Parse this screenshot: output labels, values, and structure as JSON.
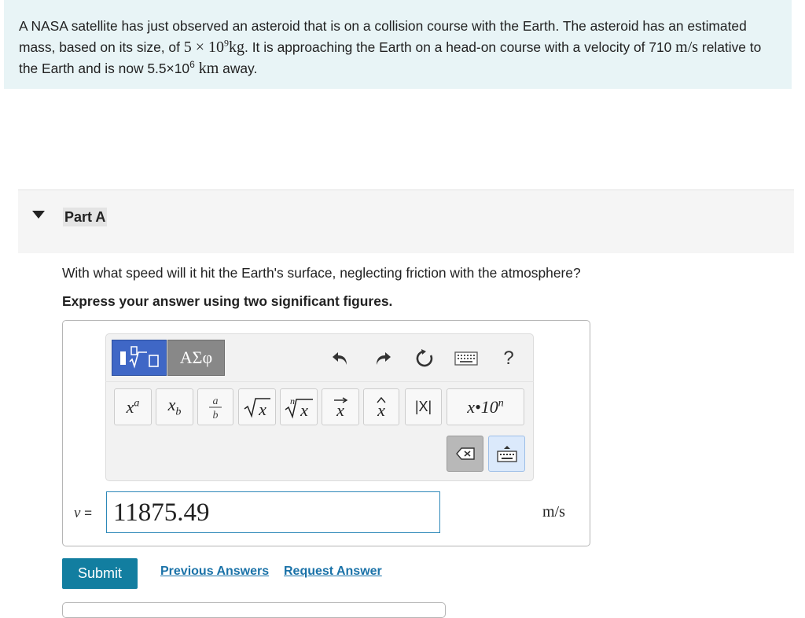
{
  "problem": {
    "text_1": "A NASA satellite has just observed an asteroid that is on a collision course with the Earth. The asteroid has an estimated mass, based on its size, of ",
    "mass_coef": "5 × 10",
    "mass_exp": "9",
    "mass_unit": "kg",
    "text_2": ". It is approaching the Earth on a head-on course with a velocity of 710 ",
    "velocity_unit": "m/s",
    "text_3": " relative to the Earth and is now 5.5×10",
    "distance_exp": "6",
    "distance_unit": " km",
    "text_4": " away."
  },
  "part": {
    "title": "Part A",
    "question": "With what speed will it hit the Earth's surface, neglecting friction with the atmosphere?",
    "instruction": "Express your answer using two significant figures."
  },
  "toolbar": {
    "greek_label": "ΑΣφ",
    "help_label": "?",
    "abs_label": "|X|",
    "sci_label_base": "x•10",
    "sci_label_exp": "n"
  },
  "answer": {
    "variable": "v",
    "equals": "=",
    "value": "11875.49",
    "unit": "m/s"
  },
  "actions": {
    "submit": "Submit",
    "previous_answers": "Previous Answers",
    "request_answer": "Request Answer"
  },
  "colors": {
    "problem_bg": "#e8f4f6",
    "submit_bg": "#127ea0",
    "link": "#1a72a8",
    "templates_btn": "#3f67c6",
    "input_border": "#2d88b8"
  }
}
